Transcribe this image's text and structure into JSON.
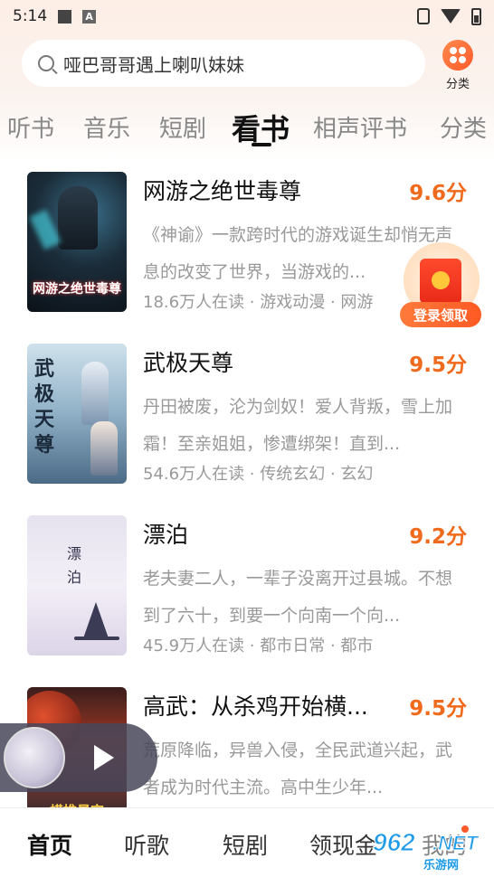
{
  "status_bar": {
    "time": "5:14",
    "notif_icon_letter": "A"
  },
  "search": {
    "placeholder": "哑巴哥哥遇上喇叭妹妹"
  },
  "category_button": {
    "label": "分类"
  },
  "tabs": [
    "听书",
    "音乐",
    "短剧",
    "看书",
    "相声评书",
    "分类"
  ],
  "active_tab": "看书",
  "books": [
    {
      "title": "网游之绝世毒尊",
      "score": "9.6分",
      "desc": "《神谕》一款跨时代的游戏诞生却悄无声息的改变了世界，当游戏的...",
      "meta": "18.6万人在读 · 游戏动漫 · 网游",
      "cover_text": "网游之绝世毒尊"
    },
    {
      "title": "武极天尊",
      "score": "9.5分",
      "desc": "丹田被废，沦为剑奴！爱人背叛，雪上加霜！至亲姐姐，惨遭绑架！直到...",
      "meta": "54.6万人在读 · 传统玄幻 · 玄幻",
      "cover_text": "武极天尊"
    },
    {
      "title": "漂泊",
      "score": "9.2分",
      "desc": "老夫妻二人，一辈子没离开过县城。不想到了六十，到要一个向南一个向...",
      "meta": "45.9万人在读 · 都市日常 · 都市",
      "cover_text": "漂泊"
    },
    {
      "title": "高武：从杀鸡开始横...",
      "score": "9.5分",
      "desc": "荒原降临，异兽入侵，全民武道兴起，武者成为时代主流。高中生少年...",
      "meta": "",
      "cover_text": "横推星空"
    }
  ],
  "login_float": {
    "label": "登录领取"
  },
  "bottom_nav": [
    "首页",
    "听歌",
    "短剧",
    "领现金",
    "我的"
  ],
  "watermark": {
    "num": "962",
    "net": ".NET",
    "sub": "乐游网"
  },
  "colors": {
    "accent": "#f06a1d",
    "tab_active": "#111111",
    "muted": "#999999"
  }
}
